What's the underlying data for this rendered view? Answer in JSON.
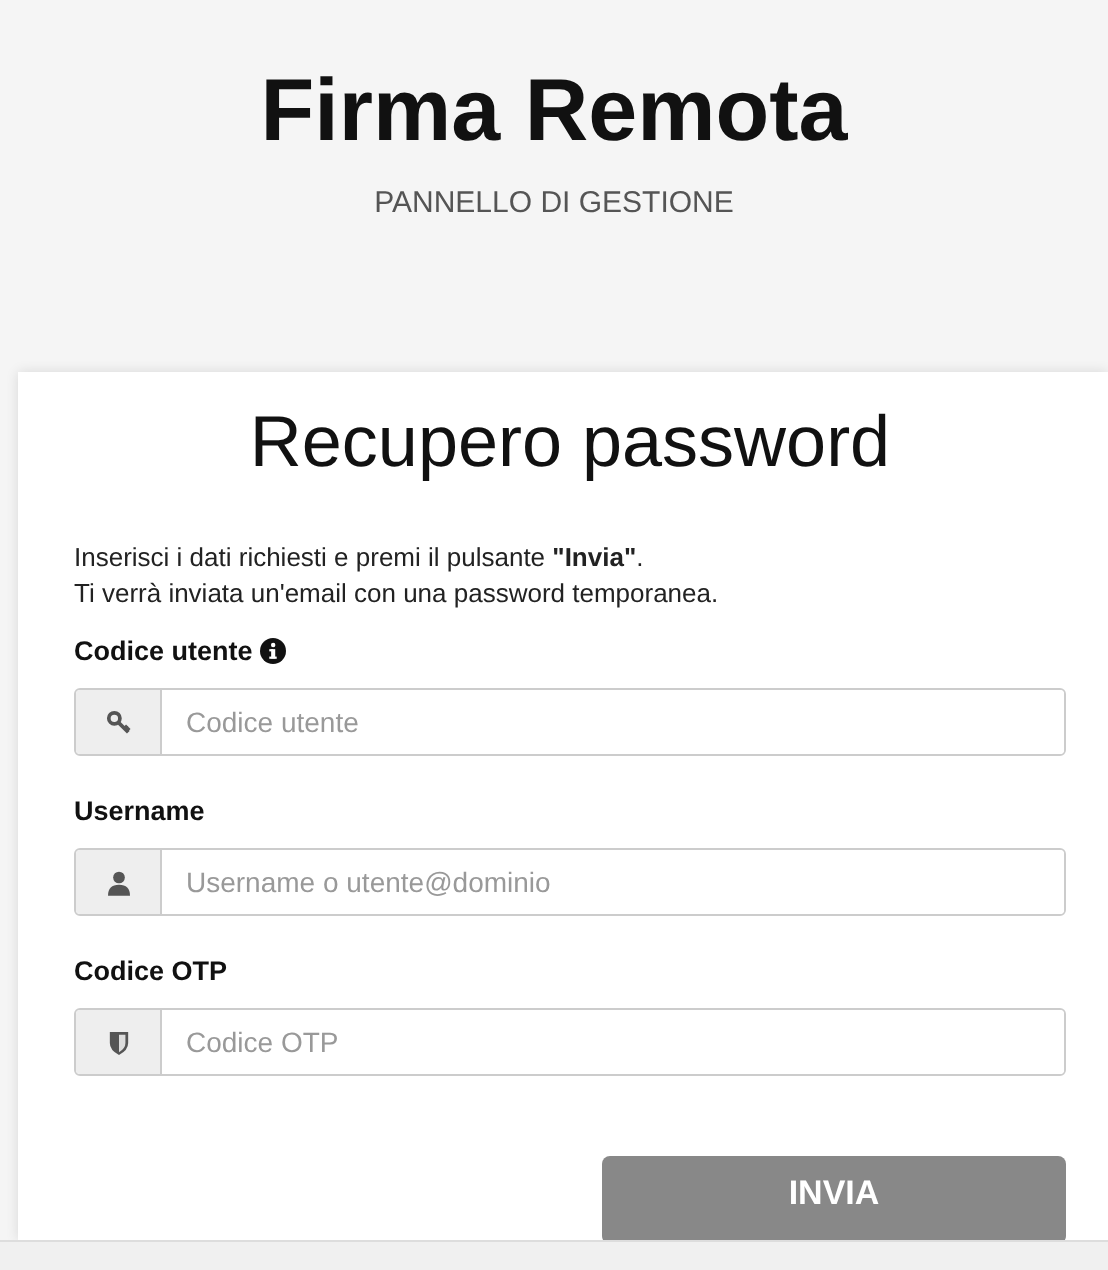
{
  "header": {
    "title": "Firma Remota",
    "subtitle": "PANNELLO DI GESTIONE"
  },
  "form": {
    "title": "Recupero password",
    "intro": [
      "Inserisci i dati richiesti e premi il pulsante **\"Invia\"**.",
      "Ti verrà inviata un'email con una password temporanea."
    ],
    "fields": [
      {
        "label": "Codice utente",
        "info": true,
        "kind": "key",
        "placeholder": "Codice utente"
      },
      {
        "label": "Username",
        "info": false,
        "kind": "user",
        "placeholder": "Username o utente@dominio"
      },
      {
        "label": "Codice OTP",
        "info": false,
        "kind": "shield",
        "placeholder": "Codice OTP"
      }
    ],
    "submit": "INVIA"
  }
}
